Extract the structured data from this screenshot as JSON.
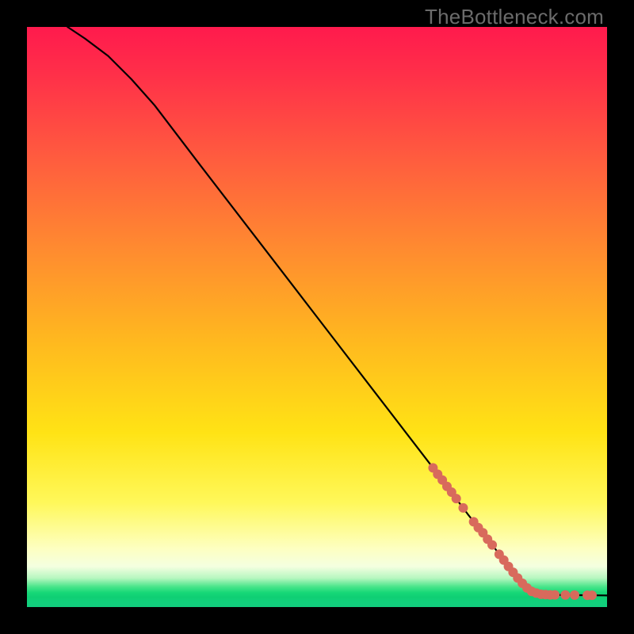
{
  "watermark": "TheBottleneck.com",
  "chart_data": {
    "type": "line",
    "title": "",
    "xlabel": "",
    "ylabel": "",
    "xlim": [
      0,
      100
    ],
    "ylim": [
      0,
      100
    ],
    "grid": false,
    "legend": false,
    "curve": [
      {
        "x": 7,
        "y": 100
      },
      {
        "x": 10,
        "y": 98
      },
      {
        "x": 14,
        "y": 95
      },
      {
        "x": 18,
        "y": 91
      },
      {
        "x": 22,
        "y": 86.5
      },
      {
        "x": 30,
        "y": 76
      },
      {
        "x": 40,
        "y": 63
      },
      {
        "x": 50,
        "y": 50
      },
      {
        "x": 60,
        "y": 37
      },
      {
        "x": 70,
        "y": 24
      },
      {
        "x": 76,
        "y": 16
      },
      {
        "x": 80,
        "y": 11
      },
      {
        "x": 83,
        "y": 7
      },
      {
        "x": 85,
        "y": 4.5
      },
      {
        "x": 86.5,
        "y": 3
      },
      {
        "x": 88,
        "y": 2.3
      },
      {
        "x": 90,
        "y": 2.1
      },
      {
        "x": 95,
        "y": 2.05
      },
      {
        "x": 100,
        "y": 2.0
      }
    ],
    "markers": [
      {
        "x": 70.0,
        "y": 24.0
      },
      {
        "x": 70.8,
        "y": 22.9
      },
      {
        "x": 71.6,
        "y": 21.9
      },
      {
        "x": 72.4,
        "y": 20.8
      },
      {
        "x": 73.2,
        "y": 19.8
      },
      {
        "x": 74.0,
        "y": 18.7
      },
      {
        "x": 75.2,
        "y": 17.1
      },
      {
        "x": 77.0,
        "y": 14.7
      },
      {
        "x": 77.8,
        "y": 13.7
      },
      {
        "x": 78.6,
        "y": 12.8
      },
      {
        "x": 79.4,
        "y": 11.7
      },
      {
        "x": 80.2,
        "y": 10.7
      },
      {
        "x": 81.4,
        "y": 9.1
      },
      {
        "x": 82.2,
        "y": 8.1
      },
      {
        "x": 83.0,
        "y": 7.0
      },
      {
        "x": 83.8,
        "y": 6.0
      },
      {
        "x": 84.6,
        "y": 5.0
      },
      {
        "x": 85.4,
        "y": 4.1
      },
      {
        "x": 86.2,
        "y": 3.3
      },
      {
        "x": 87.0,
        "y": 2.7
      },
      {
        "x": 87.8,
        "y": 2.4
      },
      {
        "x": 88.6,
        "y": 2.2
      },
      {
        "x": 89.4,
        "y": 2.15
      },
      {
        "x": 90.2,
        "y": 2.1
      },
      {
        "x": 91.0,
        "y": 2.1
      },
      {
        "x": 92.8,
        "y": 2.08
      },
      {
        "x": 94.4,
        "y": 2.06
      },
      {
        "x": 96.6,
        "y": 2.04
      },
      {
        "x": 97.4,
        "y": 2.03
      }
    ],
    "marker_color": "#d86a5c",
    "marker_radius_px": 6
  }
}
